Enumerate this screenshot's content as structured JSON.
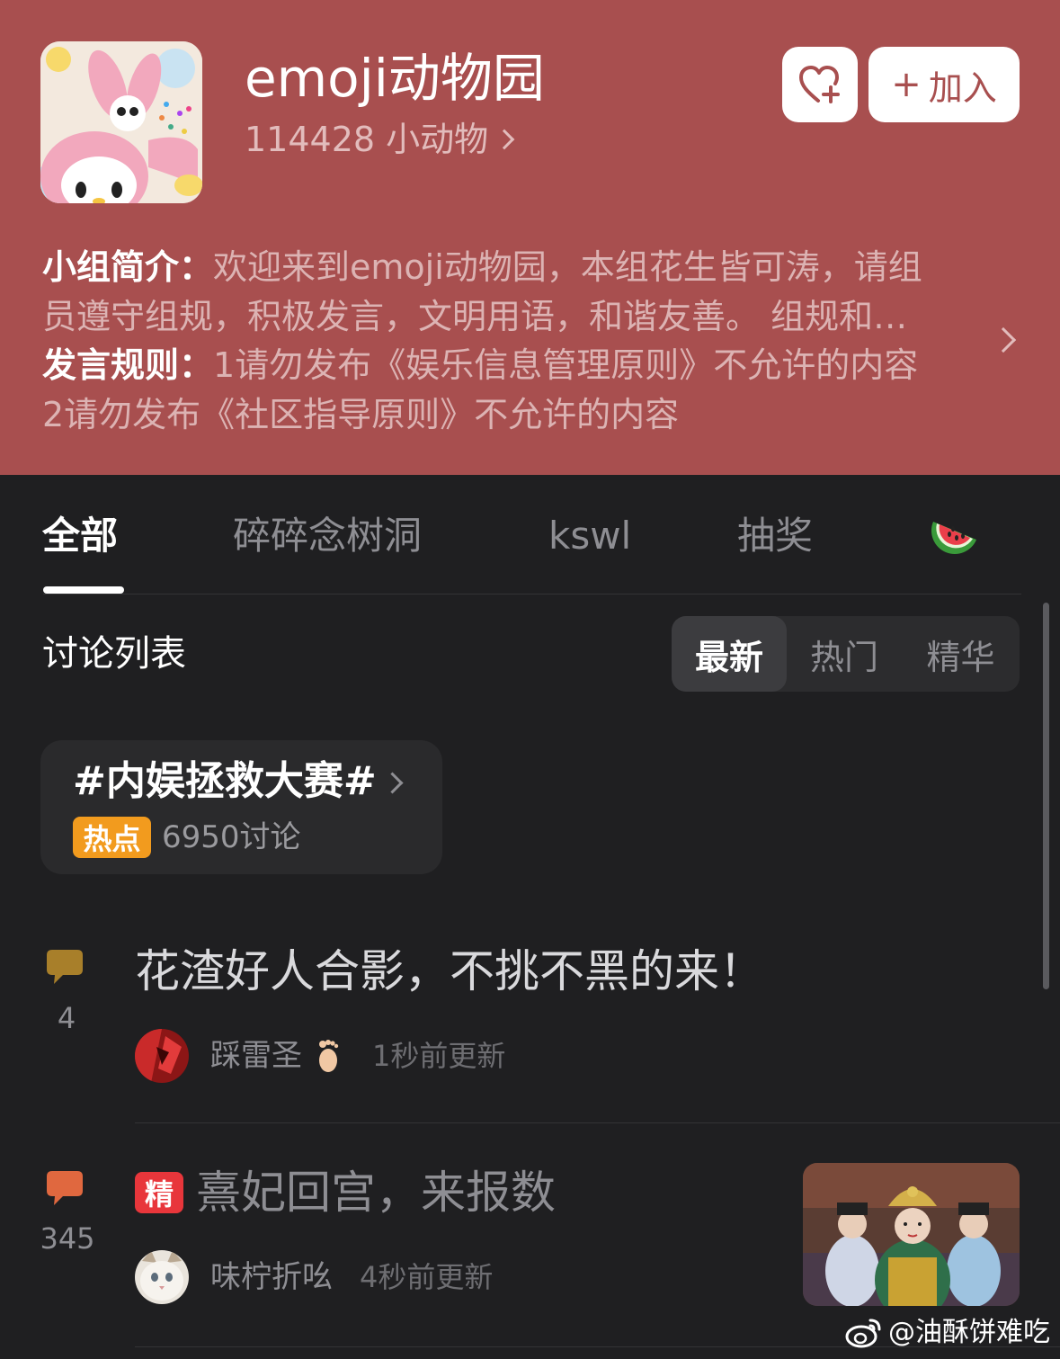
{
  "group": {
    "name": "emoji动物园",
    "member_count": "114428",
    "member_unit": "小动物",
    "join_label": "加入",
    "intro_label": "小组简介：",
    "intro_line1": "欢迎来到emoji动物园，本组花生皆可涛，请组",
    "intro_line2": "员遵守组规，积极发言，文明用语，和谐友善。 组规和…",
    "rules_label": "发言规则：",
    "rules_line1": "1请勿发布《娱乐信息管理原则》不允许的内容",
    "rules_line2": "2请勿发布《社区指导原则》不允许的内容",
    "accent_color": "#a84f4f"
  },
  "tabs": [
    {
      "label": "全部",
      "active": true
    },
    {
      "label": "碎碎念树洞"
    },
    {
      "label": "kswl"
    },
    {
      "label": "抽奖"
    },
    {
      "label": "",
      "icon": "watermelon-icon"
    }
  ],
  "discussion": {
    "title": "讨论列表",
    "sort_options": [
      "最新",
      "热门",
      "精华"
    ],
    "active_sort": "最新"
  },
  "topic": {
    "title": "#内娱拯救大赛#",
    "badge": "热点",
    "count": "6950讨论"
  },
  "posts": [
    {
      "reply_count": "4",
      "title": "花渣好人合影，不挑不黑的来！",
      "author": "踩雷圣",
      "author_emoji": "🦶",
      "time": "1秒前更新",
      "bubble_color": "#a87f2a"
    },
    {
      "reply_count": "345",
      "badge": "精",
      "title": "熹妃回宫，来报数",
      "author": "味柠折吆",
      "time": "4秒前更新",
      "bubble_color": "#e0683f"
    }
  ],
  "watermark": "@油酥饼难吃"
}
